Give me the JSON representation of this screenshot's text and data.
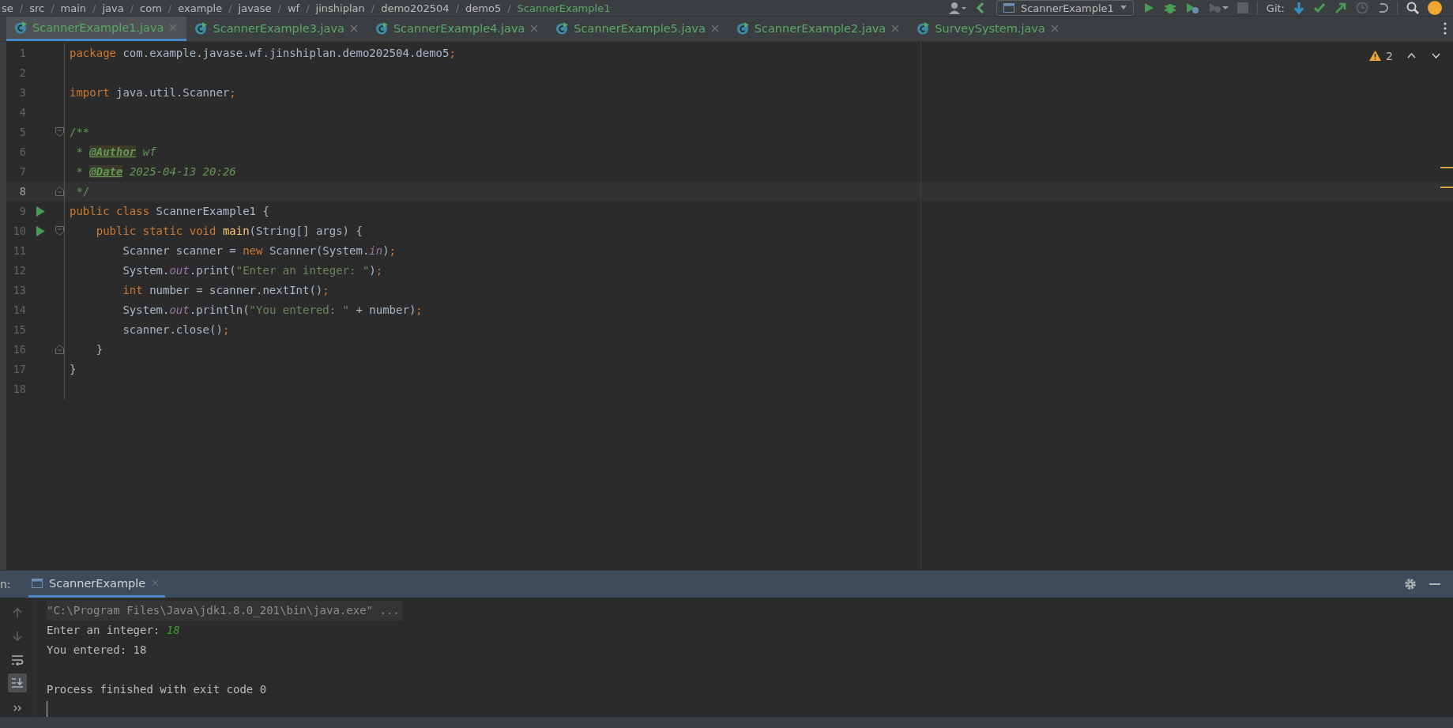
{
  "breadcrumb": [
    {
      "kind": "crumb",
      "text": "se"
    },
    {
      "kind": "separator",
      "text": "/"
    },
    {
      "kind": "crumb",
      "text": "src"
    },
    {
      "kind": "separator",
      "text": "/"
    },
    {
      "kind": "crumb",
      "text": "main"
    },
    {
      "kind": "separator",
      "text": "/"
    },
    {
      "kind": "crumb",
      "text": "java"
    },
    {
      "kind": "separator",
      "text": "/"
    },
    {
      "kind": "crumb",
      "text": "com"
    },
    {
      "kind": "separator",
      "text": "/"
    },
    {
      "kind": "crumb",
      "text": "example"
    },
    {
      "kind": "separator",
      "text": "/"
    },
    {
      "kind": "crumb",
      "text": "javase"
    },
    {
      "kind": "separator",
      "text": "/"
    },
    {
      "kind": "crumb",
      "text": "wf"
    },
    {
      "kind": "separator",
      "text": "/"
    },
    {
      "kind": "crumb",
      "text": "jinshiplan"
    },
    {
      "kind": "separator",
      "text": "/"
    },
    {
      "kind": "crumb",
      "text": "demo202504"
    },
    {
      "kind": "separator",
      "text": "/"
    },
    {
      "kind": "crumb",
      "text": "demo5"
    },
    {
      "kind": "separator",
      "text": "/"
    },
    {
      "kind": "file",
      "text": "ScannerExample1"
    }
  ],
  "toolbar": {
    "run_config": "ScannerExample1",
    "vcs_label": "Git:"
  },
  "tabs": [
    {
      "label": "ScannerExample1.java",
      "selected": true
    },
    {
      "label": "ScannerExample3.java",
      "selected": false
    },
    {
      "label": "ScannerExample4.java",
      "selected": false
    },
    {
      "label": "ScannerExample5.java",
      "selected": false
    },
    {
      "label": "ScannerExample2.java",
      "selected": false
    },
    {
      "label": "SurveySystem.java",
      "selected": false
    }
  ],
  "inspections": {
    "warning_count": "2"
  },
  "editor": {
    "lines": [
      {
        "number": "1",
        "current": false,
        "run": false,
        "tokens": [
          {
            "t": "package",
            "kind": "kw"
          },
          {
            "t": " com.example.javase.wf.jinshiplan.demo202504.demo5",
            "kind": "txt"
          },
          {
            "t": ";",
            "kind": "kw"
          }
        ]
      },
      {
        "number": "2",
        "current": false,
        "run": false
      },
      {
        "number": "3",
        "current": false,
        "run": false,
        "tokens": [
          {
            "t": "import",
            "kind": "kw"
          },
          {
            "t": " java.util.Scanner",
            "kind": "txt"
          },
          {
            "t": ";",
            "kind": "kw"
          }
        ]
      },
      {
        "number": "4",
        "current": false,
        "run": false
      },
      {
        "number": "5",
        "current": false,
        "run": false,
        "folding": {
          "kind": "start"
        },
        "tokens": [
          {
            "t": "/**",
            "kind": "doc"
          }
        ]
      },
      {
        "number": "6",
        "current": false,
        "run": false,
        "tokens": [
          {
            "t": " * ",
            "kind": "doc"
          },
          {
            "t": "@Author",
            "kind": "tag"
          },
          {
            "t": " wf",
            "kind": "docval"
          }
        ]
      },
      {
        "number": "7",
        "current": false,
        "run": false,
        "tokens": [
          {
            "t": " * ",
            "kind": "doc"
          },
          {
            "t": "@Date",
            "kind": "tag"
          },
          {
            "t": " 2025-04-13 20:26",
            "kind": "docval"
          }
        ]
      },
      {
        "number": "8",
        "current": true,
        "run": false,
        "folding": {
          "kind": "end"
        },
        "tokens": [
          {
            "t": " */",
            "kind": "doc"
          }
        ]
      },
      {
        "number": "9",
        "current": false,
        "run": true,
        "tokens": [
          {
            "t": "public class ",
            "kind": "kw"
          },
          {
            "t": "ScannerExample1 {",
            "kind": "txt"
          }
        ]
      },
      {
        "number": "10",
        "current": false,
        "run": true,
        "folding": {
          "kind": "start"
        },
        "tokens": [
          {
            "t": "    public static void ",
            "kind": "kw"
          },
          {
            "t": "main",
            "kind": "fn"
          },
          {
            "t": "(String[] args) {",
            "kind": "txt"
          }
        ]
      },
      {
        "number": "11",
        "current": false,
        "run": false,
        "tokens": [
          {
            "t": "        Scanner scanner = ",
            "kind": "txt"
          },
          {
            "t": "new ",
            "kind": "kw"
          },
          {
            "t": "Scanner(System.",
            "kind": "txt"
          },
          {
            "t": "in",
            "kind": "field"
          },
          {
            "t": ")",
            "kind": "txt"
          },
          {
            "t": ";",
            "kind": "kw"
          }
        ]
      },
      {
        "number": "12",
        "current": false,
        "run": false,
        "tokens": [
          {
            "t": "        System.",
            "kind": "txt"
          },
          {
            "t": "out",
            "kind": "field"
          },
          {
            "t": ".print(",
            "kind": "txt"
          },
          {
            "t": "\"Enter an integer: \"",
            "kind": "str"
          },
          {
            "t": ")",
            "kind": "txt"
          },
          {
            "t": ";",
            "kind": "kw"
          }
        ]
      },
      {
        "number": "13",
        "current": false,
        "run": false,
        "tokens": [
          {
            "t": "        int ",
            "kind": "kw"
          },
          {
            "t": "number = scanner.nextInt()",
            "kind": "txt"
          },
          {
            "t": ";",
            "kind": "kw"
          }
        ]
      },
      {
        "number": "14",
        "current": false,
        "run": false,
        "tokens": [
          {
            "t": "        System.",
            "kind": "txt"
          },
          {
            "t": "out",
            "kind": "field"
          },
          {
            "t": ".println(",
            "kind": "txt"
          },
          {
            "t": "\"You entered: \"",
            "kind": "str"
          },
          {
            "t": " + number)",
            "kind": "txt"
          },
          {
            "t": ";",
            "kind": "kw"
          }
        ]
      },
      {
        "number": "15",
        "current": false,
        "run": false,
        "tokens": [
          {
            "t": "        scanner.close()",
            "kind": "txt"
          },
          {
            "t": ";",
            "kind": "kw"
          }
        ]
      },
      {
        "number": "16",
        "current": false,
        "run": false,
        "folding": {
          "kind": "end"
        },
        "tokens": [
          {
            "t": "    }",
            "kind": "txt"
          }
        ]
      },
      {
        "number": "17",
        "current": false,
        "run": false,
        "tokens": [
          {
            "t": "}",
            "kind": "txt"
          }
        ]
      },
      {
        "number": "18",
        "current": false,
        "run": false
      }
    ]
  },
  "run_panel": {
    "label": "n:",
    "tab": "ScannerExample",
    "console": [
      {
        "kind": "command",
        "segments": [
          {
            "t": "\"C:\\Program Files\\Java\\jdk1.8.0_201\\bin\\java.exe\" ...",
            "kind": "out"
          }
        ]
      },
      {
        "kind": "output",
        "segments": [
          {
            "t": "Enter an integer: ",
            "kind": "out"
          },
          {
            "t": "18",
            "kind": "input"
          }
        ]
      },
      {
        "kind": "output",
        "segments": [
          {
            "t": "You entered: 18",
            "kind": "out"
          }
        ]
      },
      {
        "kind": "exit",
        "segments": [
          {
            "t": "Process finished with exit code 0",
            "kind": "out"
          }
        ]
      }
    ]
  }
}
